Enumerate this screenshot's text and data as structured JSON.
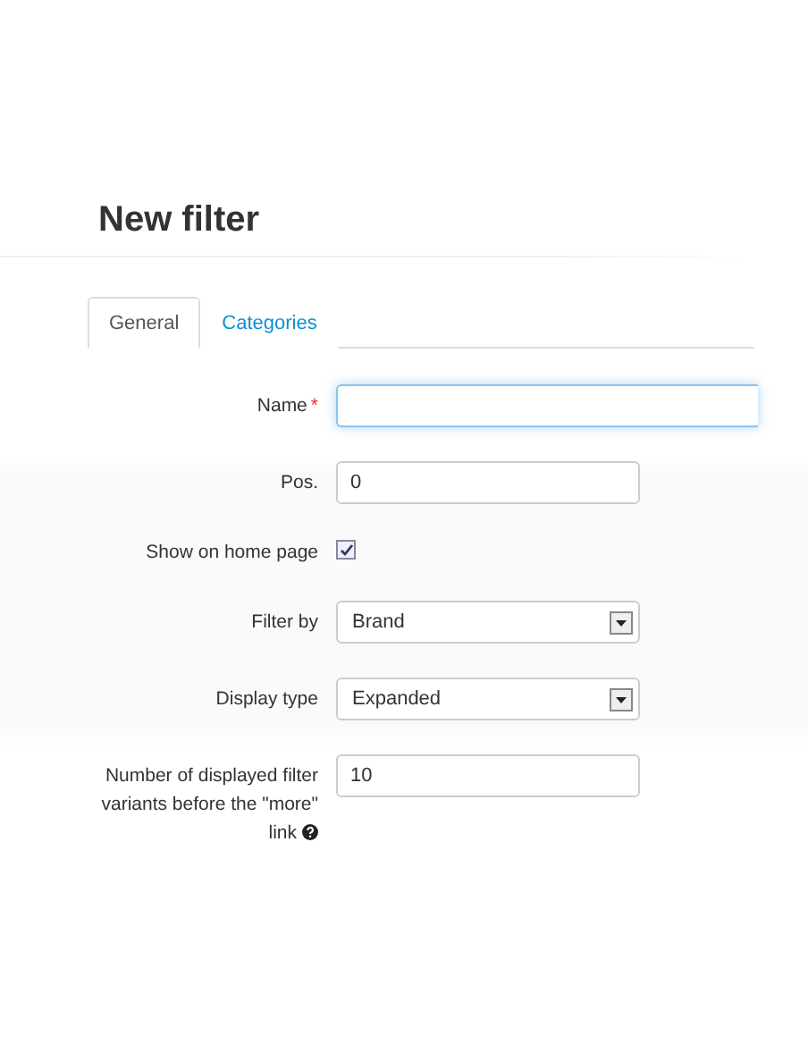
{
  "title": "New filter",
  "tabs": [
    {
      "label": "General",
      "selected": true
    },
    {
      "label": "Categories",
      "selected": false
    }
  ],
  "fields": [
    {
      "kind": "text",
      "label": "Name",
      "required_mark": "*",
      "focused": true,
      "wide": true
    },
    {
      "kind": "text",
      "label": "Pos.",
      "value": "0",
      "focused": false,
      "wide": false
    },
    {
      "kind": "checkbox",
      "label": "Show on home page",
      "checked": true
    },
    {
      "kind": "select",
      "label": "Filter by",
      "value": "Brand"
    },
    {
      "kind": "select",
      "label": "Display type",
      "value": "Expanded"
    },
    {
      "kind": "text",
      "label": "Number of displayed filter variants before the \"more\" link",
      "value": "10",
      "focused": false,
      "wide": false,
      "help": true
    }
  ]
}
